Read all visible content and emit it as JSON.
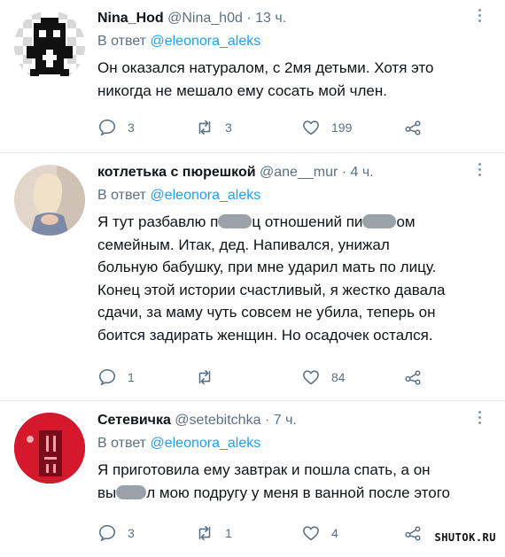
{
  "tweets": [
    {
      "name": "Nina_Hod",
      "handle": "@Nina_h0d",
      "dot": "·",
      "time": "13 ч.",
      "reply_prefix": "В ответ",
      "reply_to": "@eleonora_aleks",
      "text_lines": [
        "Он оказался натуралом, с 2мя детьми. Хотя это",
        "никогда не мешало ему сосать мой член."
      ],
      "replies": "3",
      "retweets": "3",
      "likes": "199"
    },
    {
      "name": "котлетька с пюрешкой",
      "handle": "@ane__mur",
      "dot": "·",
      "time": "4 ч.",
      "reply_prefix": "В ответ",
      "reply_to": "@eleonora_aleks",
      "text_parts": [
        "Я тут разбавлю п",
        "ц отношений пи",
        "ом"
      ],
      "text_lines": [
        "семейным. Итак, дед. Напивался, унижал",
        "больную бабушку, при мне ударил мать по лицу.",
        "Конец этой истории счастливый, я жестко давала",
        "сдачи, за маму чуть совсем не убила, теперь он",
        "боится задирать женщин. Но осадочек остался."
      ],
      "replies": "1",
      "retweets": "",
      "likes": "84"
    },
    {
      "name": "Сетевичка",
      "handle": "@setebitchka",
      "dot": "·",
      "time": "7 ч.",
      "reply_prefix": "В ответ",
      "reply_to": "@eleonora_aleks",
      "text_line1": "Я приготовила ему завтрак и пошла спать, а он",
      "text_parts": [
        "вы",
        "л мою подругу у меня в ванной после этого"
      ],
      "replies": "3",
      "retweets": "1",
      "likes": "4"
    }
  ],
  "watermark": "SHUTOK.RU",
  "colors": {
    "link": "#1da1f2",
    "muted": "#5b7083",
    "separator": "#e6ecf0"
  },
  "icons": [
    "reply-icon",
    "retweet-icon",
    "like-icon",
    "share-icon",
    "more-icon"
  ]
}
